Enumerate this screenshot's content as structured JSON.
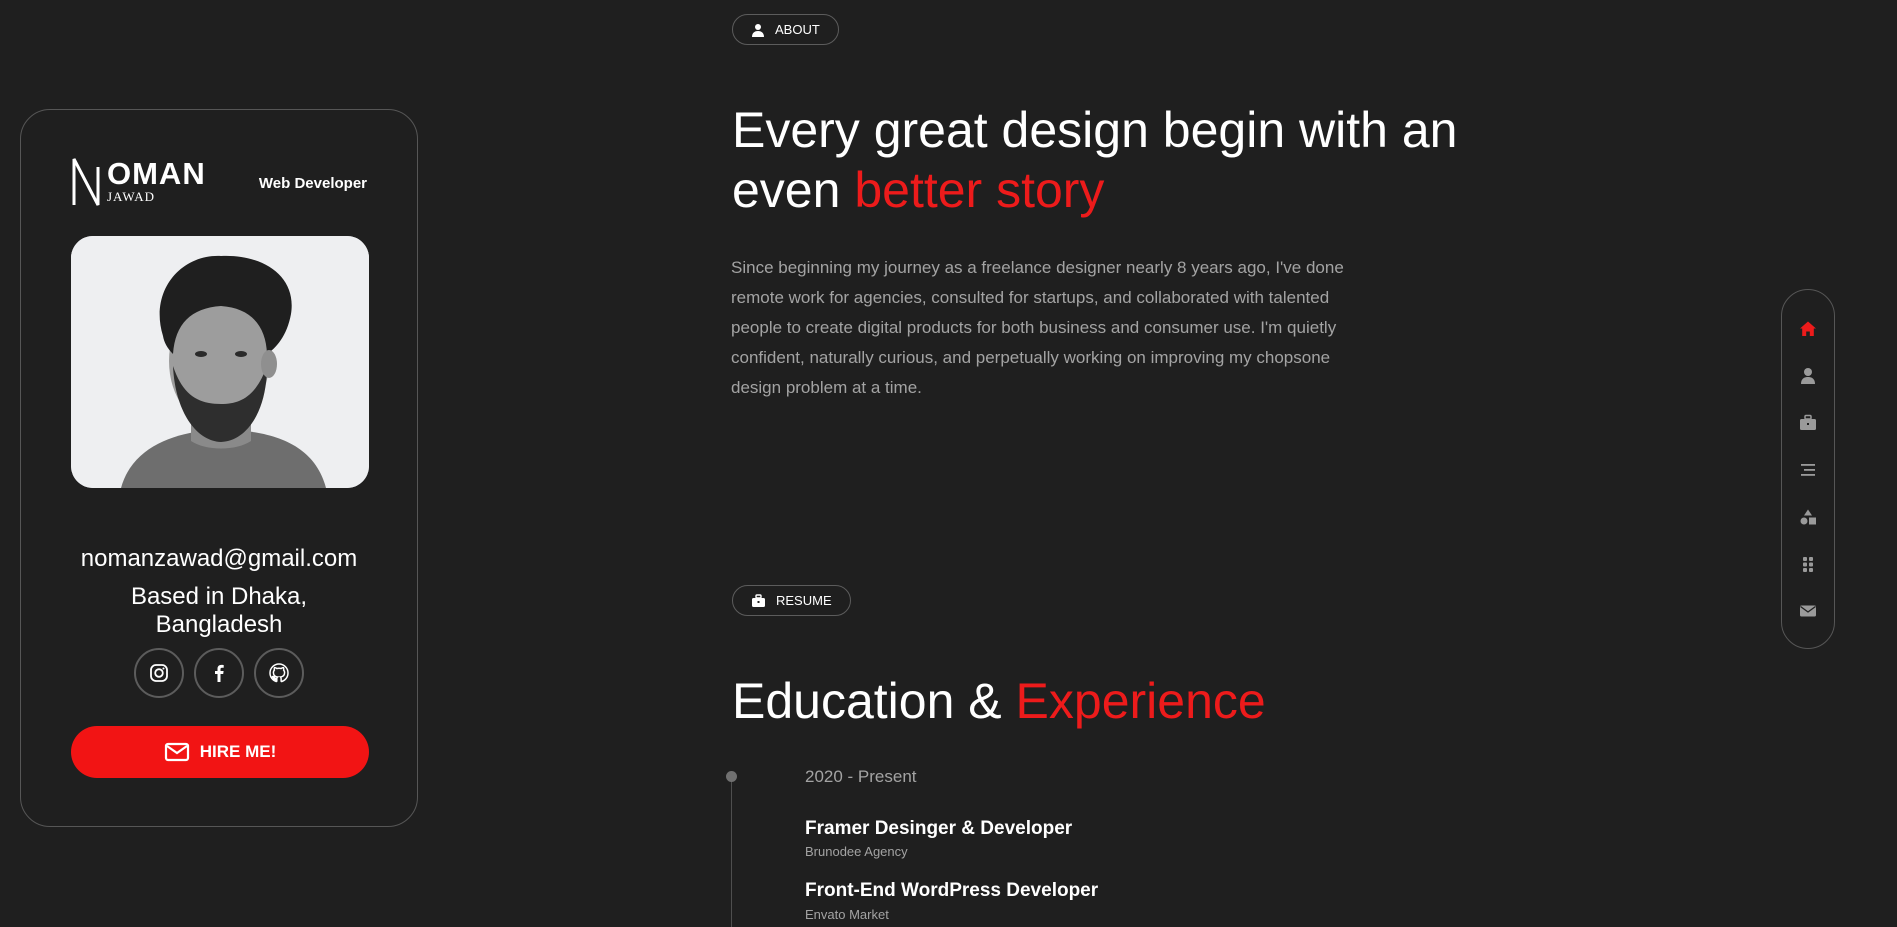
{
  "profile": {
    "logo_word": "OMAN",
    "logo_sub": "JAWAD",
    "role": "Web Developer",
    "email": "nomanzawad@gmail.com",
    "location_line1": "Based in Dhaka,",
    "location_line2": "Bangladesh",
    "hire_label": "HIRE ME!",
    "socials": [
      "instagram-icon",
      "facebook-icon",
      "github-icon"
    ]
  },
  "about": {
    "pill_label": "ABOUT",
    "heading_part1": "Every great design begin with an even ",
    "heading_accent": "better story",
    "body": "Since beginning my journey as a freelance designer nearly 8 years ago, I've done remote work for agencies, consulted for startups, and collaborated with talented people to create digital products for both business and consumer use. I'm quietly confident, naturally curious, and perpetually working on improving my chopsone design problem at a time."
  },
  "resume": {
    "pill_label": "RESUME",
    "heading_part1": "Education & ",
    "heading_accent": "Experience",
    "period": "2020 - Present",
    "jobs": [
      {
        "title": "Framer Desinger & Developer",
        "org": "Brunodee Agency"
      },
      {
        "title": "Front-End WordPress Developer",
        "org": "Envato Market"
      }
    ]
  },
  "side_nav": {
    "items": [
      "home-icon",
      "user-icon",
      "briefcase-icon",
      "menu-lines-icon",
      "shapes-icon",
      "grid-icon",
      "envelope-icon"
    ],
    "active": "home-icon"
  },
  "colors": {
    "background": "#1f1f1f",
    "accent": "#ed1b1b",
    "button": "#f21414",
    "muted_text": "#a3a3a3"
  }
}
